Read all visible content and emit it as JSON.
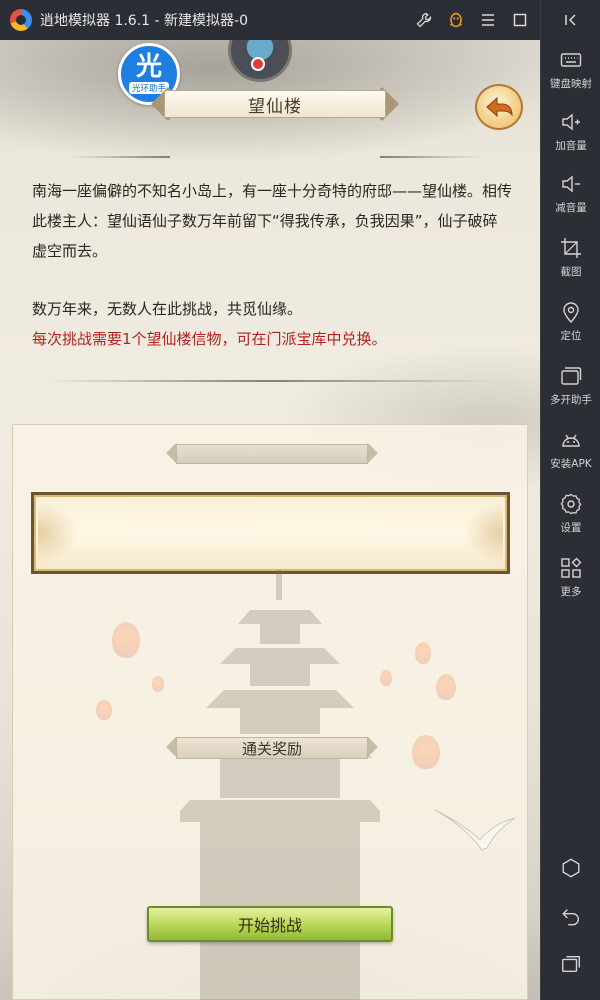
{
  "window": {
    "title": "逍地模拟器 1.6.1 - 新建模拟器-0"
  },
  "sidebar": {
    "items": [
      {
        "label": "键盘映射",
        "icon": "keyboard-icon"
      },
      {
        "label": "加音量",
        "icon": "volume-up-icon"
      },
      {
        "label": "减音量",
        "icon": "volume-down-icon"
      },
      {
        "label": "截图",
        "icon": "crop-icon"
      },
      {
        "label": "定位",
        "icon": "location-pin-icon"
      },
      {
        "label": "多开助手",
        "icon": "multi-window-icon"
      },
      {
        "label": "安装APK",
        "icon": "android-icon"
      },
      {
        "label": "设置",
        "icon": "gear-icon"
      },
      {
        "label": "更多",
        "icon": "grid-plus-icon"
      }
    ]
  },
  "game": {
    "helper_badge": {
      "main": "光",
      "sub": "光环助手"
    },
    "title": "望仙楼",
    "description": {
      "paragraph1": "南海一座偏僻的不知名小岛上，有一座十分奇特的府邸——望仙楼。相传此楼主人：望仙语仙子数万年前留下“得我传承，负我因果”，仙子破碎虚空而去。",
      "paragraph2": "数万年来，无数人在此挑战，共觅仙缘。",
      "requirement": "每次挑战需要1个望仙楼信物，可在门派宝库中兑换。"
    },
    "reward_header": "通关奖励",
    "start_button": "开始挑战"
  },
  "colors": {
    "requirement_text": "#b0241b",
    "start_button": "#b7d654",
    "helper_badge": "#1f7fe0",
    "chrome": "#2b2e35"
  }
}
